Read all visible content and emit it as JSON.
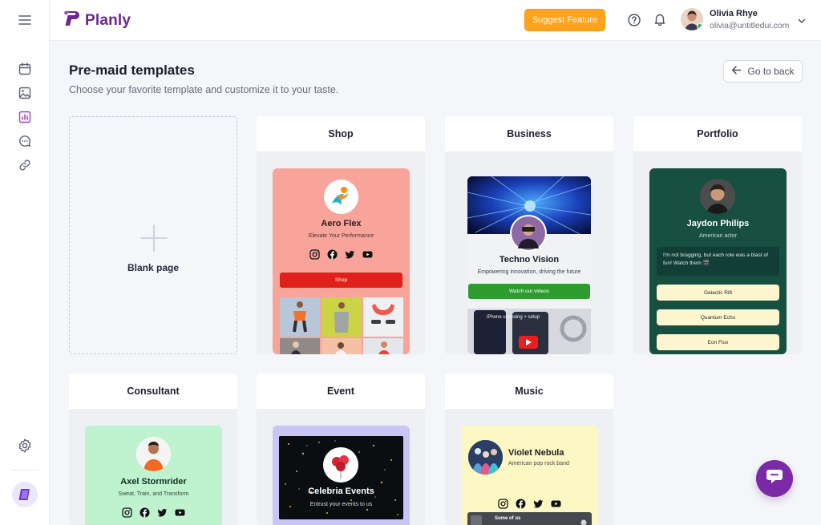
{
  "app": {
    "name": "Planly"
  },
  "header": {
    "suggest_label": "Suggest Feature",
    "user": {
      "name": "Olivia Rhye",
      "email": "olivia@untitledui.com"
    }
  },
  "page": {
    "title": "Pre-maid templates",
    "subtitle": "Choose your favorite template and customize it to your taste.",
    "back_label": "Go to back"
  },
  "sidebar": {
    "items": [
      {
        "icon": "calendar-icon",
        "active": false
      },
      {
        "icon": "image-icon",
        "active": false
      },
      {
        "icon": "chart-icon",
        "active": true
      },
      {
        "icon": "chat-icon",
        "active": false
      },
      {
        "icon": "link-icon",
        "active": false
      }
    ]
  },
  "templates": {
    "blank": {
      "label": "Blank page"
    },
    "shop": {
      "title": "Shop",
      "preview": {
        "name": "Aero Flex",
        "tagline": "Elevate Your Performance",
        "button": "Shop"
      }
    },
    "business": {
      "title": "Business",
      "preview": {
        "name": "Techno Vision",
        "tagline": "Empowering innovation, driving the future",
        "button": "Watch our videos",
        "video_caption": "iPhone unboxing + setup"
      }
    },
    "portfolio": {
      "title": "Portfolio",
      "preview": {
        "name": "Jaydon Philips",
        "tagline": "American actor",
        "quote": "I'm not bragging, but each role was a blast of fun! Watch them 🎬",
        "links": [
          "Galactic Rift",
          "Quantum Echo",
          "Eon Flux"
        ]
      }
    },
    "consultant": {
      "title": "Consultant",
      "preview": {
        "name": "Axel Stormrider",
        "tagline": "Sweat, Train, and Transform"
      }
    },
    "event": {
      "title": "Event",
      "preview": {
        "name": "Celebria Events",
        "tagline": "Entrust your events to us"
      }
    },
    "music": {
      "title": "Music",
      "preview": {
        "name": "Violet Nebula",
        "tagline": "American pop rock band",
        "track": "Some of us"
      }
    }
  },
  "colors": {
    "brand": "#6b2690",
    "suggest": "#ffa21d",
    "shop_bg": "#f8a49a",
    "shop_button": "#e0201a",
    "business_button": "#2e9b2e",
    "portfolio_bg": "#174f41",
    "portfolio_button": "#fdf6cf",
    "consultant_bg": "#bff3cf",
    "event_bg": "#c9c6f6",
    "music_bg": "#fcf7c3",
    "fab": "#7a2aa6"
  }
}
